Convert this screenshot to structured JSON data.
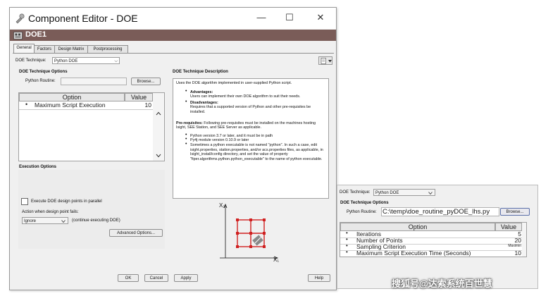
{
  "window": {
    "title": "Component Editor - DOE",
    "minimize": "—",
    "maximize": "☐",
    "close": "✕",
    "component_name": "DOE1"
  },
  "tabs": [
    "General",
    "Factors",
    "Design Matrix",
    "Postprocessing"
  ],
  "technique": {
    "label": "DOE Technique:",
    "value": "Python DOE",
    "arrow": "⌵"
  },
  "options": {
    "section_title": "DOE Technique Options",
    "routine_label": "Python Routine:",
    "browse_label": "Browse...",
    "table": {
      "headers": [
        "Option",
        "Value"
      ],
      "rows": [
        {
          "bullet": "•",
          "option": "Maximum Script Execution",
          "value": "10"
        }
      ]
    }
  },
  "description": {
    "section_title": "DOE Technique Description",
    "intro": "Uses the DOE algorithm implemented in user-supplied Python script.",
    "advantages_title": "Advantages:",
    "advantages_text": "Users can implement their own DOE algorithm to suit their needs.",
    "disadvantages_title": "Disadvantages:",
    "disadvantages_text": "Requires that a supported version of Python and other pre-requisites be installed.",
    "prereq_title": "Pre-requisites:",
    "prereq_text": "Following pre-requisites must be installed on the machines hosting Isight, SEE Station, and SEE Server as applicable.",
    "bullets": [
      "Python version 3.7 or later, and it must be in path",
      "Py4j module version 0.10.9 or later",
      "Sometimes a python executable is not named \"python\". In such a case, edit isight.properties, station.properties, and/or acs.properties files, as applicable, in Isight_install/config directory, and set the value of property \"fiper.algorithms.python.python_executable\" to the name of python executable."
    ]
  },
  "execution": {
    "section_title": "Execution Options",
    "parallel_label": "Execute DOE design points in parallel",
    "fail_label": "Action when design point fails:",
    "fail_value": "Ignore",
    "fail_note": "(continue executing DOE)",
    "advanced_button": "Advanced Options..."
  },
  "buttons": {
    "ok": "OK",
    "cancel": "Cancel",
    "apply": "Apply",
    "help": "Help"
  },
  "diagram": {
    "y_label": "X₂",
    "x_label": "X₁"
  },
  "popup": {
    "technique_label": "DOE Technique:",
    "technique_value": "Python DOE",
    "section_title": "DOE Technique Options",
    "routine_label": "Python Routine:",
    "routine_value": "C:\\temp\\doe_routine_pyDOE_lhs.py",
    "browse_label": "Browse...",
    "table": {
      "headers": [
        "Option",
        "Value"
      ],
      "rows": [
        {
          "bullet": "•",
          "option": "Iterations",
          "value": "5"
        },
        {
          "bullet": "•",
          "option": "Number of Points",
          "value": "20"
        },
        {
          "bullet": "•",
          "option": "Sampling Criterion",
          "value": "Maximin"
        },
        {
          "bullet": "•",
          "option": "Maximum Script Execution Time (Seconds)",
          "value": "10"
        }
      ]
    }
  },
  "watermark": "搜狐号@达索系统百世慧"
}
